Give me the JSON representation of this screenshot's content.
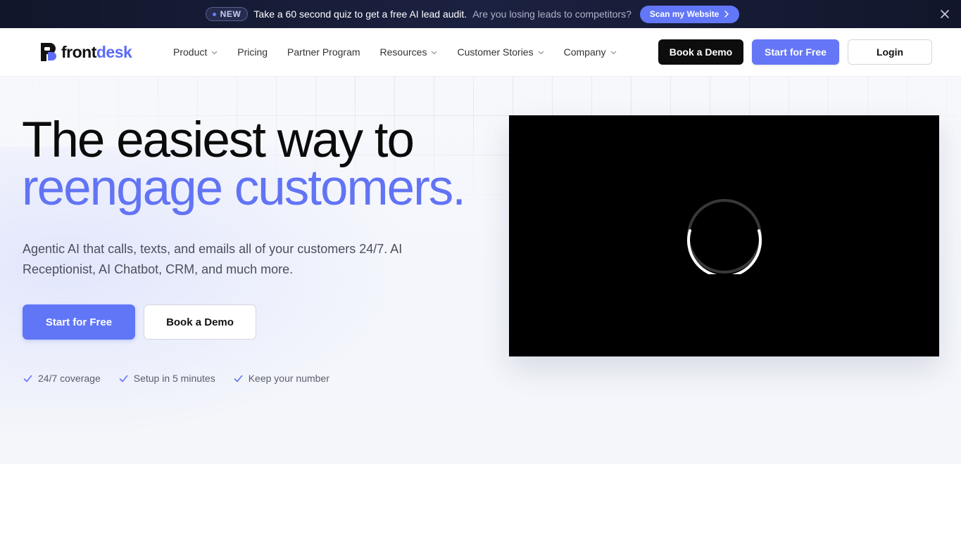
{
  "announcement": {
    "badge": "NEW",
    "text": "Take a 60 second quiz to get a free AI lead audit.",
    "subtext": "Are you losing leads to competitors?",
    "cta": "Scan my Website",
    "cta_icon": "chevron-right-icon",
    "close_icon": "close-icon"
  },
  "nav": {
    "logo": {
      "part1": "front",
      "part2": "desk"
    },
    "links": [
      {
        "label": "Product",
        "has_dropdown": true
      },
      {
        "label": "Pricing",
        "has_dropdown": false
      },
      {
        "label": "Partner Program",
        "has_dropdown": false
      },
      {
        "label": "Resources",
        "has_dropdown": true
      },
      {
        "label": "Customer Stories",
        "has_dropdown": true
      },
      {
        "label": "Company",
        "has_dropdown": true
      }
    ],
    "book_demo": "Book a Demo",
    "start_free": "Start for Free",
    "login": "Login"
  },
  "hero": {
    "headline_line1": "The easiest way to",
    "headline_line2": "reengage customers.",
    "subtext": "Agentic AI that calls, texts, and emails all of your customers 24/7. AI Receptionist, AI Chatbot, CRM, and much more.",
    "start_free": "Start for Free",
    "book_demo": "Book a Demo",
    "checks": [
      "24/7 coverage",
      "Setup in 5 minutes",
      "Keep your number"
    ]
  },
  "colors": {
    "accent": "#6274f4",
    "dark": "#0d0d0d",
    "announce_bg": "#151a33"
  }
}
